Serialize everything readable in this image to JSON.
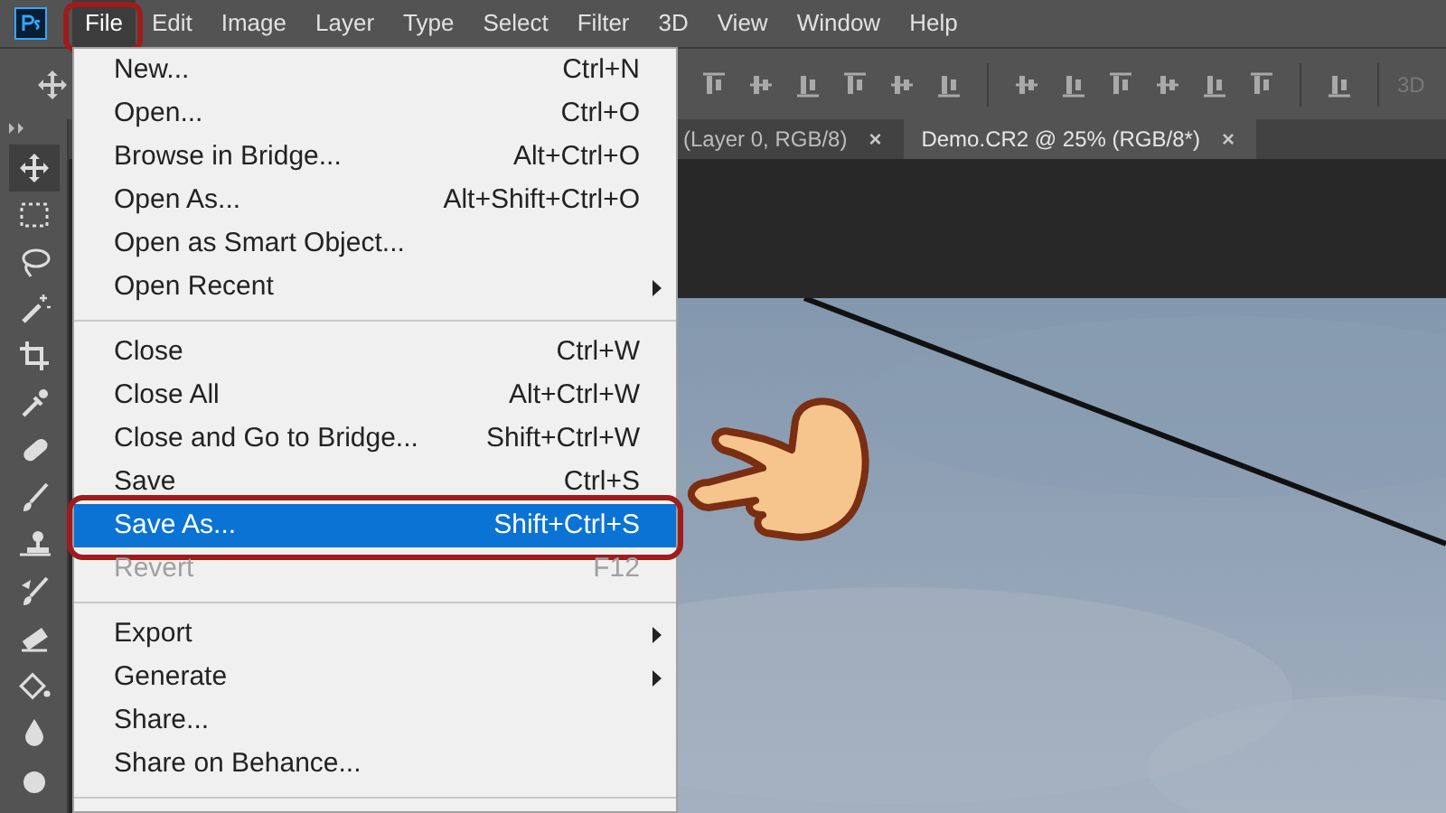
{
  "menu_bar": {
    "items": [
      {
        "label": "File",
        "selected": true,
        "outlined": true
      },
      {
        "label": "Edit",
        "selected": false,
        "outlined": false
      },
      {
        "label": "Image",
        "selected": false,
        "outlined": false
      },
      {
        "label": "Layer",
        "selected": false,
        "outlined": false
      },
      {
        "label": "Type",
        "selected": false,
        "outlined": false
      },
      {
        "label": "Select",
        "selected": false,
        "outlined": false
      },
      {
        "label": "Filter",
        "selected": false,
        "outlined": false
      },
      {
        "label": "3D",
        "selected": false,
        "outlined": false
      },
      {
        "label": "View",
        "selected": false,
        "outlined": false
      },
      {
        "label": "Window",
        "selected": false,
        "outlined": false
      },
      {
        "label": "Help",
        "selected": false,
        "outlined": false
      }
    ]
  },
  "options_bar": {
    "trailing_label": "3D"
  },
  "document_tabs": [
    {
      "label": "(Layer 0, RGB/8)",
      "close": "×",
      "selected": false
    },
    {
      "label": "Demo.CR2 @ 25% (RGB/8*)",
      "close": "×",
      "selected": true
    }
  ],
  "file_menu": {
    "items": [
      {
        "kind": "item",
        "label": "New...",
        "shortcut": "Ctrl+N",
        "submenu": false,
        "disabled": false,
        "selected": false,
        "outlined": false
      },
      {
        "kind": "item",
        "label": "Open...",
        "shortcut": "Ctrl+O",
        "submenu": false,
        "disabled": false,
        "selected": false,
        "outlined": false
      },
      {
        "kind": "item",
        "label": "Browse in Bridge...",
        "shortcut": "Alt+Ctrl+O",
        "submenu": false,
        "disabled": false,
        "selected": false,
        "outlined": false
      },
      {
        "kind": "item",
        "label": "Open As...",
        "shortcut": "Alt+Shift+Ctrl+O",
        "submenu": false,
        "disabled": false,
        "selected": false,
        "outlined": false
      },
      {
        "kind": "item",
        "label": "Open as Smart Object...",
        "submenu": false,
        "disabled": false,
        "selected": false,
        "outlined": false
      },
      {
        "kind": "item",
        "label": "Open Recent",
        "submenu": true,
        "disabled": false,
        "selected": false,
        "outlined": false
      },
      {
        "kind": "separator"
      },
      {
        "kind": "item",
        "label": "Close",
        "shortcut": "Ctrl+W",
        "submenu": false,
        "disabled": false,
        "selected": false,
        "outlined": false
      },
      {
        "kind": "item",
        "label": "Close All",
        "shortcut": "Alt+Ctrl+W",
        "submenu": false,
        "disabled": false,
        "selected": false,
        "outlined": false
      },
      {
        "kind": "item",
        "label": "Close and Go to Bridge...",
        "shortcut": "Shift+Ctrl+W",
        "submenu": false,
        "disabled": false,
        "selected": false,
        "outlined": false
      },
      {
        "kind": "item",
        "label": "Save",
        "shortcut": "Ctrl+S",
        "submenu": false,
        "disabled": false,
        "selected": false,
        "outlined": false
      },
      {
        "kind": "item",
        "label": "Save As...",
        "shortcut": "Shift+Ctrl+S",
        "submenu": false,
        "disabled": false,
        "selected": true,
        "outlined": true
      },
      {
        "kind": "item",
        "label": "Revert",
        "shortcut": "F12",
        "submenu": false,
        "disabled": true,
        "selected": false,
        "outlined": false
      },
      {
        "kind": "separator"
      },
      {
        "kind": "item",
        "label": "Export",
        "submenu": true,
        "disabled": false,
        "selected": false,
        "outlined": false
      },
      {
        "kind": "item",
        "label": "Generate",
        "submenu": true,
        "disabled": false,
        "selected": false,
        "outlined": false
      },
      {
        "kind": "item",
        "label": "Share...",
        "submenu": false,
        "disabled": false,
        "selected": false,
        "outlined": false
      },
      {
        "kind": "item",
        "label": "Share on Behance...",
        "submenu": false,
        "disabled": false,
        "selected": false,
        "outlined": false
      },
      {
        "kind": "separator"
      }
    ]
  }
}
